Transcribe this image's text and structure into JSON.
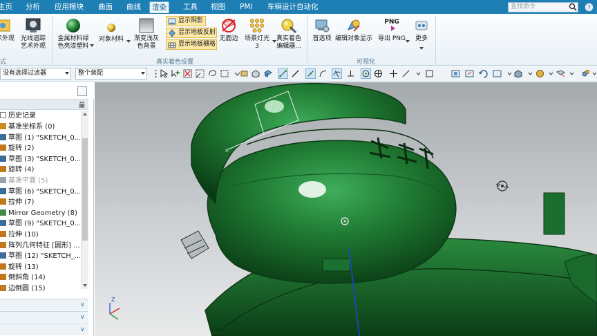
{
  "menu": {
    "tabs": [
      "主页",
      "分析",
      "应用模块",
      "曲面",
      "曲线",
      "渲染",
      "工具",
      "视图",
      "PMI",
      "车辆设计自动化"
    ],
    "active": "渲染",
    "search_placeholder": "查找命令"
  },
  "ribbon": {
    "left_cut_label1": "术外观",
    "left_cut_label2": "式",
    "btn_ray_art": "光线追踪\n艺术外观",
    "btn_metal": "金属材料绿\n色亮漆塑料",
    "btn_object_material": "对象材料",
    "btn_gradient_bg": "渐变浅灰\n色背景",
    "toggle_shadow": "显示阴影",
    "toggle_reflection": "显示地板反射",
    "toggle_grid": "显示地板栅格",
    "btn_no_edge": "无面边",
    "btn_scene_light": "场景灯光 3",
    "btn_true_shading_editor": "真实着色\n编辑器...",
    "group_true_shading": "真实着色设置",
    "btn_preferences": "首选项",
    "btn_edit_object_display": "编辑对象显示",
    "btn_export_png": "导出 PNG",
    "btn_more": "更多",
    "png_icon_text": "PNG",
    "group_visualization": "可视化"
  },
  "toolbar": {
    "filter_value": "没有选择过滤器",
    "assembly_value": "整个装配"
  },
  "navigator": {
    "header_col": "最",
    "root_label": "历史记录",
    "items": [
      {
        "label": "基准坐标系 (0)",
        "icon": "datum-csys-icon",
        "dim": false
      },
      {
        "label": "草图 (1) \"SKETCH_0...",
        "icon": "sketch-icon",
        "dim": false
      },
      {
        "label": "旋转 (2)",
        "icon": "revolve-icon",
        "dim": false
      },
      {
        "label": "草图 (3) \"SKETCH_0...",
        "icon": "sketch-icon",
        "dim": false
      },
      {
        "label": "旋转 (4)",
        "icon": "revolve-icon",
        "dim": false
      },
      {
        "label": "基准平面 (5)",
        "icon": "datum-plane-icon",
        "dim": true
      },
      {
        "label": "草图 (6) \"SKETCH_0...",
        "icon": "sketch-icon",
        "dim": false
      },
      {
        "label": "拉伸 (7)",
        "icon": "extrude-icon",
        "dim": false
      },
      {
        "label": "Mirror Geometry (8)",
        "icon": "mirror-icon",
        "dim": false
      },
      {
        "label": "草图 (9) \"SKETCH_0...",
        "icon": "sketch-icon",
        "dim": false
      },
      {
        "label": "拉伸 (10)",
        "icon": "extrude-icon",
        "dim": false
      },
      {
        "label": "阵列几何特征 [圆形] ...",
        "icon": "pattern-icon",
        "dim": false
      },
      {
        "label": "草图 (12) \"SKETCH_...",
        "icon": "sketch-icon",
        "dim": false
      },
      {
        "label": "旋转 (13)",
        "icon": "revolve-icon",
        "dim": false
      },
      {
        "label": "倒斜角 (14)",
        "icon": "chamfer-icon",
        "dim": false
      },
      {
        "label": "边倒圆 (15)",
        "icon": "blend-icon",
        "dim": false
      }
    ]
  },
  "viewport": {
    "triad_label": "Z",
    "model_color": "#1f7a32",
    "model_highlight": "#3fae5c"
  }
}
